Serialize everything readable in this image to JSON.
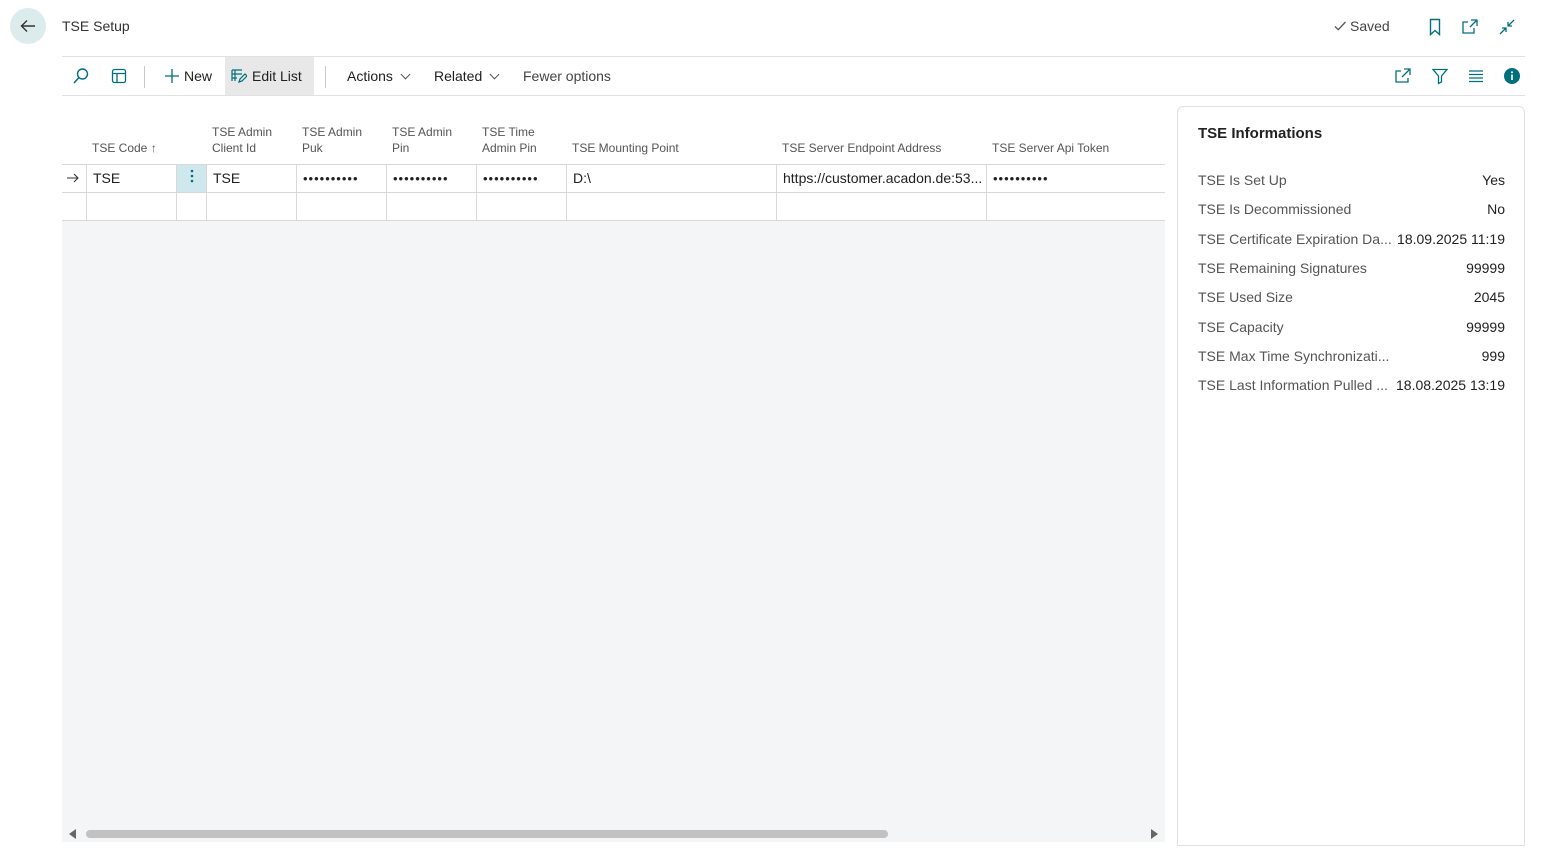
{
  "header": {
    "title": "TSE Setup",
    "saved_label": "Saved"
  },
  "toolbar": {
    "new_label": "New",
    "edit_list_label": "Edit List",
    "actions_label": "Actions",
    "related_label": "Related",
    "fewer_options_label": "Fewer options"
  },
  "grid": {
    "columns": [
      {
        "line1": "",
        "line2": "TSE Code ↑"
      },
      {
        "line1": "TSE Admin",
        "line2": "Client Id"
      },
      {
        "line1": "TSE Admin",
        "line2": "Puk"
      },
      {
        "line1": "TSE Admin",
        "line2": "Pin"
      },
      {
        "line1": "TSE Time",
        "line2": "Admin Pin"
      },
      {
        "line1": "",
        "line2": "TSE Mounting Point"
      },
      {
        "line1": "",
        "line2": "TSE Server Endpoint Address"
      },
      {
        "line1": "",
        "line2": "TSE Server Api Token"
      }
    ],
    "rows": [
      {
        "code": "TSE",
        "client_id": "TSE",
        "puk": "••••••••••",
        "pin": "••••••••••",
        "time_admin_pin": "••••••••••",
        "mounting_point": "D:\\",
        "endpoint": "https://customer.acadon.de:53...",
        "api_token": "••••••••••"
      }
    ]
  },
  "factbox": {
    "title": "TSE Informations",
    "items": [
      {
        "label": "TSE Is Set Up",
        "value": "Yes"
      },
      {
        "label": "TSE Is Decommissioned",
        "value": "No"
      },
      {
        "label": "TSE Certificate Expiration Da...",
        "value": "18.09.2025 11:19"
      },
      {
        "label": "TSE Remaining Signatures",
        "value": "99999"
      },
      {
        "label": "TSE Used Size",
        "value": "2045"
      },
      {
        "label": "TSE Capacity",
        "value": "99999"
      },
      {
        "label": "TSE Max Time Synchronizati...",
        "value": "999"
      },
      {
        "label": "TSE Last Information Pulled ...",
        "value": "18.08.2025 13:19"
      }
    ]
  },
  "colors": {
    "accent": "#00707a",
    "selected_cell": "#cfe8ee"
  }
}
